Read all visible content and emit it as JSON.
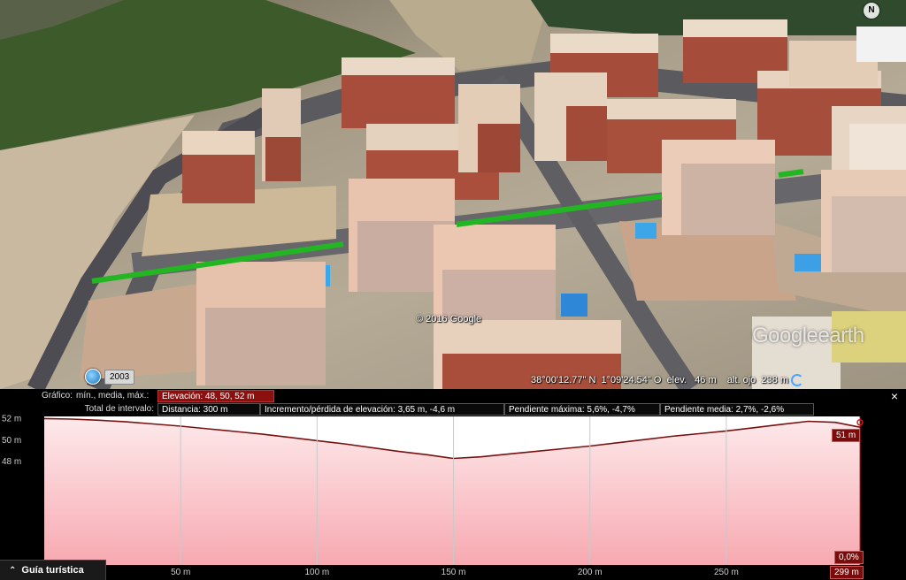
{
  "map": {
    "copyright": "© 2016 Google",
    "logo_main": "Google",
    "logo_sub": "earth",
    "north_label": "N",
    "year": "2003",
    "status": {
      "lat": "38°00'12.77\" N",
      "lon": "1°09'24.54\" O",
      "elev_label": "elev.",
      "elev_value": "46 m",
      "eye_label": "alt. ojo",
      "eye_value": "238 m"
    },
    "path_color": "#22b722"
  },
  "profile": {
    "graph_label": "Gráfico:",
    "graph_modes": "mín., media, máx.:",
    "elevation_stats": "Elevación: 48, 50, 52 m",
    "interval_label": "Total de intervalo:",
    "distance": "Distancia: 300 m",
    "elevation_change": "Incremento/pérdida de elevación: 3,65 m, -4,6 m",
    "max_slope": "Pendiente máxima: 5,6%, -4,7%",
    "avg_slope": "Pendiente media: 2,7%, -2,6%",
    "close_label": "×",
    "current_elevation": "51 m",
    "current_slope": "0,0%",
    "current_distance": "299 m",
    "tour_guide": "Guía turística",
    "colors": {
      "fill": "#fbe5e7",
      "line": "#7a1010",
      "active": "#8b1111"
    }
  },
  "chart_data": {
    "type": "area",
    "x": [
      0,
      10,
      20,
      30,
      40,
      50,
      60,
      70,
      80,
      90,
      100,
      110,
      120,
      130,
      140,
      150,
      160,
      170,
      180,
      190,
      200,
      210,
      220,
      230,
      240,
      250,
      260,
      270,
      280,
      290,
      299
    ],
    "y": [
      52,
      51.95,
      51.85,
      51.7,
      51.5,
      51.3,
      51.05,
      50.8,
      50.55,
      50.25,
      49.95,
      49.65,
      49.3,
      48.95,
      48.65,
      48.3,
      48.45,
      48.7,
      48.95,
      49.2,
      49.45,
      49.75,
      50.05,
      50.35,
      50.6,
      50.85,
      51.15,
      51.45,
      51.75,
      51.65,
      51.2
    ],
    "xticks": [
      {
        "value": 50,
        "label": "50 m"
      },
      {
        "value": 100,
        "label": "100 m"
      },
      {
        "value": 150,
        "label": "150 m"
      },
      {
        "value": 200,
        "label": "200 m"
      },
      {
        "value": 250,
        "label": "250 m"
      }
    ],
    "yticks": [
      {
        "value": 52,
        "label": "52 m"
      },
      {
        "value": 50,
        "label": "50 m"
      },
      {
        "value": 48,
        "label": "48 m"
      }
    ],
    "xlim": [
      0,
      299
    ],
    "ylim": [
      38.4,
      52.2
    ],
    "grid": true
  }
}
